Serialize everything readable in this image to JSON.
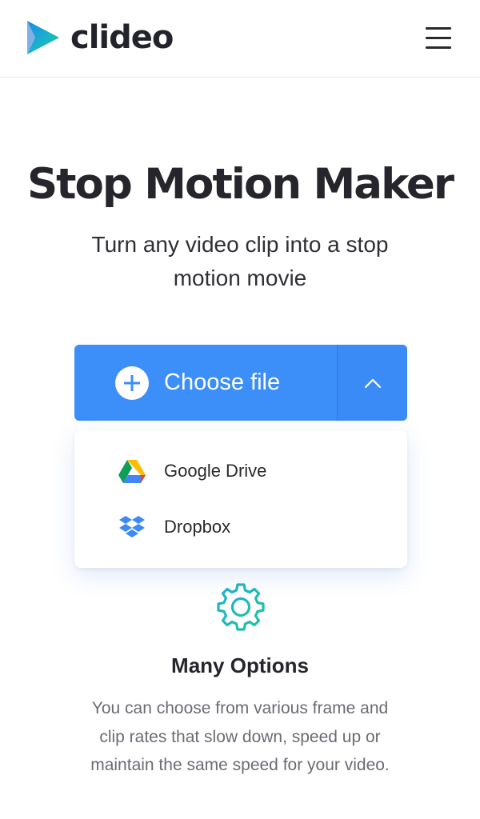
{
  "header": {
    "brand": "clideo",
    "logo_icon": "clideo-play-logo-icon",
    "menu_icon": "hamburger-menu-icon"
  },
  "hero": {
    "title": "Stop Motion Maker",
    "subtitle": "Turn any video clip into a stop motion movie"
  },
  "upload": {
    "choose_label": "Choose file",
    "plus_icon": "plus-circle-icon",
    "toggle_icon": "chevron-up-icon",
    "options": [
      {
        "label": "Google Drive",
        "icon": "google-drive-icon"
      },
      {
        "label": "Dropbox",
        "icon": "dropbox-icon"
      }
    ]
  },
  "feature": {
    "icon": "gear-icon",
    "title": "Many Options",
    "description": "You can choose from various frame and clip rates that slow down, speed up or maintain the same speed for your video."
  },
  "colors": {
    "primary": "#3c8ff8",
    "teal_gradient_start": "#1fb8c4",
    "teal_gradient_end": "#22c08a",
    "text": "#25252b",
    "muted_text": "#6b6b73"
  }
}
